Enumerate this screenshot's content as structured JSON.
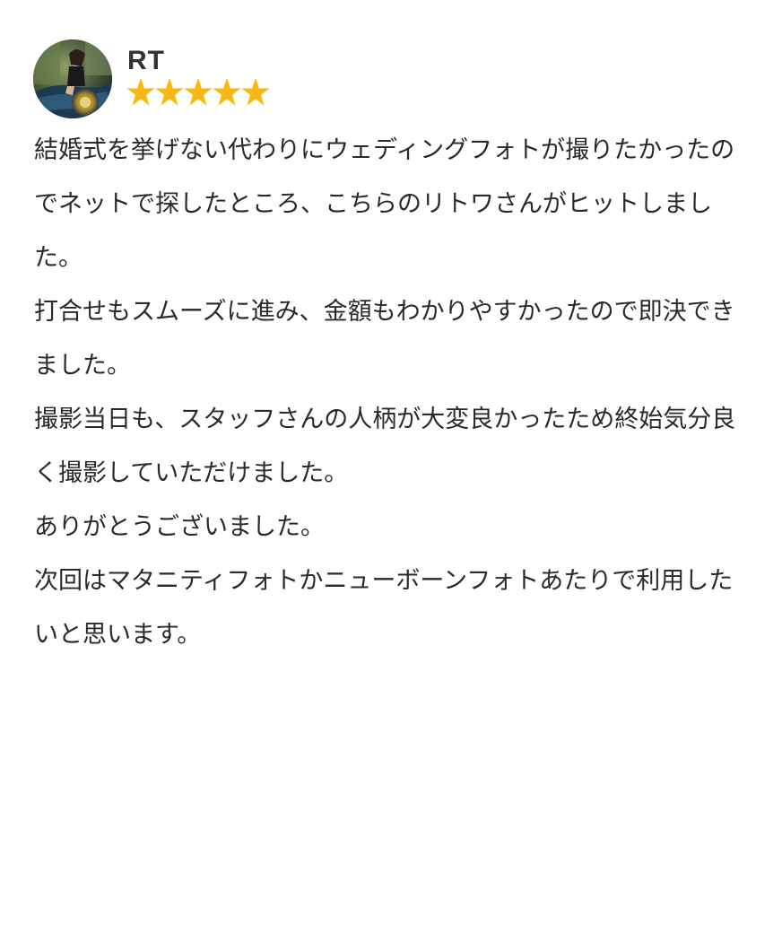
{
  "review": {
    "reviewer_name": "RT",
    "rating": 5,
    "rating_max": 5,
    "star_color": "#f6b90f",
    "avatar_icon": "user-avatar-photo",
    "paragraphs": [
      "結婚式を挙げない代わりにウェディングフォトが撮りたかったのでネットで探したところ、こちらのリトワさんがヒットしました。",
      "打合せもスムーズに進み、金額もわかりやすかったので即決できました。",
      "撮影当日も、スタッフさんの人柄が大変良かったため終始気分良く撮影していただけました。",
      "ありがとうございました。",
      "次回はマタニティフォトかニューボーンフォトあたりで利用したいと思います。"
    ]
  }
}
